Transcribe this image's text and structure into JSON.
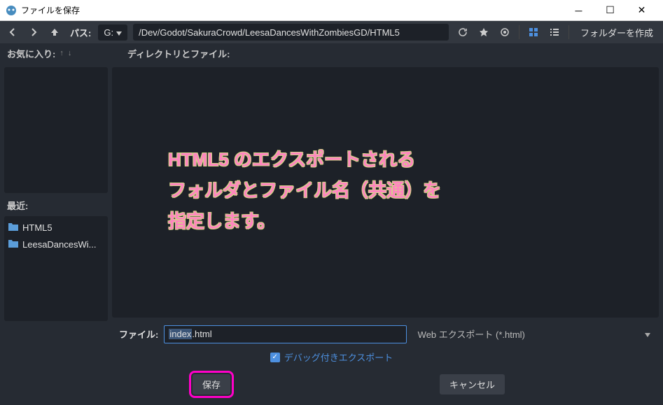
{
  "window": {
    "title": "ファイルを保存"
  },
  "toolbar": {
    "path_label": "パス:",
    "drive": "G:",
    "path": "/Dev/Godot/SakuraCrowd/LeesaDancesWithZombiesGD/HTML5",
    "create_folder": "フォルダーを作成"
  },
  "subheader": {
    "favorites_label": "お気に入り:",
    "dir_files_label": "ディレクトリとファイル:"
  },
  "sidebar": {
    "recent_label": "最近:",
    "items": [
      {
        "label": "HTML5"
      },
      {
        "label": "LeesaDancesWi..."
      }
    ]
  },
  "annotation": {
    "line1": "HTML5 のエクスポートされる",
    "line2": "フォルダとファイル名（共通）を",
    "line3": "指定します。"
  },
  "file": {
    "label": "ファイル:",
    "value_selected": "index",
    "value_rest": ".html",
    "filter": "Web エクスポート (*.html)"
  },
  "debug": {
    "label": "デバッグ付きエクスポート"
  },
  "buttons": {
    "save": "保存",
    "cancel": "キャンセル"
  }
}
